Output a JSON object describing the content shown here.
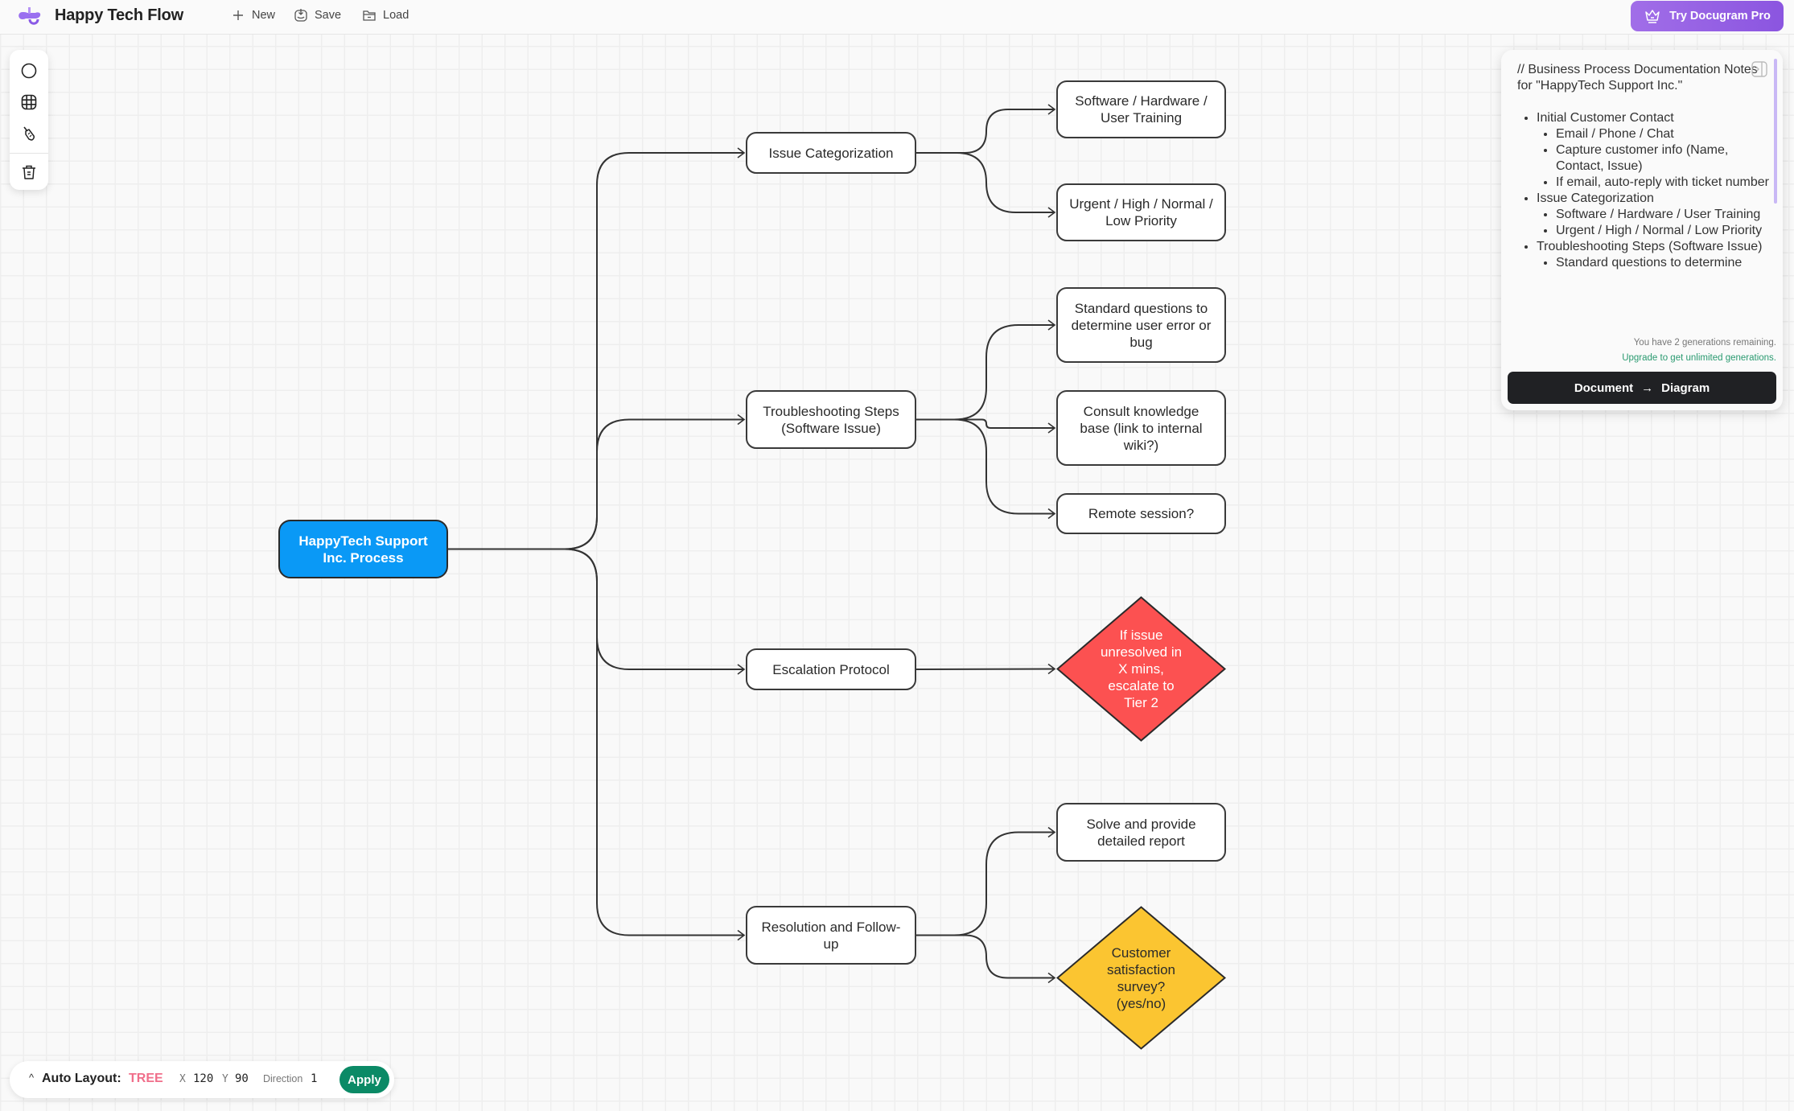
{
  "header": {
    "app_title": "Happy Tech Flow",
    "new_label": "New",
    "save_label": "Save",
    "load_label": "Load",
    "pro_label": "Try Docugram Pro"
  },
  "toolbar": {
    "tools": [
      "circle-tool",
      "grid-toggle",
      "clean-brush",
      "delete"
    ]
  },
  "diagram": {
    "root": {
      "label": "HappyTech Support Inc. Process",
      "color": "#0a99f6"
    },
    "branches": [
      {
        "label": "Issue Categorization",
        "children": [
          {
            "label": "Software / Hardware / User Training",
            "shape": "rect"
          },
          {
            "label": "Urgent / High / Normal / Low Priority",
            "shape": "rect"
          }
        ]
      },
      {
        "label": "Troubleshooting Steps (Software Issue)",
        "children": [
          {
            "label": "Standard questions to determine user error or bug",
            "shape": "rect"
          },
          {
            "label": "Consult knowledge base (link to internal wiki?)",
            "shape": "rect"
          },
          {
            "label": "Remote session?",
            "shape": "rect"
          }
        ]
      },
      {
        "label": "Escalation Protocol",
        "children": [
          {
            "label": "If issue unresolved in X mins, escalate to Tier 2",
            "shape": "diamond",
            "color": "#fc5151"
          }
        ]
      },
      {
        "label": "Resolution and Follow-up",
        "children": [
          {
            "label": "Solve and provide detailed report",
            "shape": "rect"
          },
          {
            "label": "Customer satisfaction survey? (yes/no)",
            "shape": "diamond",
            "color": "#fbc531"
          }
        ]
      }
    ]
  },
  "notes": {
    "heading": "// Business Process Documentation Notes for \"HappyTech Support Inc.\"",
    "items": [
      {
        "text": "Initial Customer Contact",
        "sub": [
          "Email / Phone / Chat",
          "Capture customer info (Name, Contact, Issue)",
          "If email, auto-reply with ticket number"
        ]
      },
      {
        "text": "Issue Categorization",
        "sub": [
          "Software / Hardware / User Training",
          "Urgent / High / Normal / Low Priority"
        ]
      },
      {
        "text": "Troubleshooting Steps (Software Issue)",
        "sub": [
          "Standard questions to determine"
        ]
      }
    ],
    "generations_remaining": "You have 2 generations remaining.",
    "upgrade_link": "Upgrade to get unlimited generations.",
    "convert_from": "Document",
    "convert_to": "Diagram"
  },
  "layout_bar": {
    "label": "Auto Layout:",
    "mode": "TREE",
    "x_label": "X",
    "x_value": "120",
    "y_label": "Y",
    "y_value": "90",
    "direction_label": "Direction",
    "direction_value": "1",
    "apply_label": "Apply"
  }
}
